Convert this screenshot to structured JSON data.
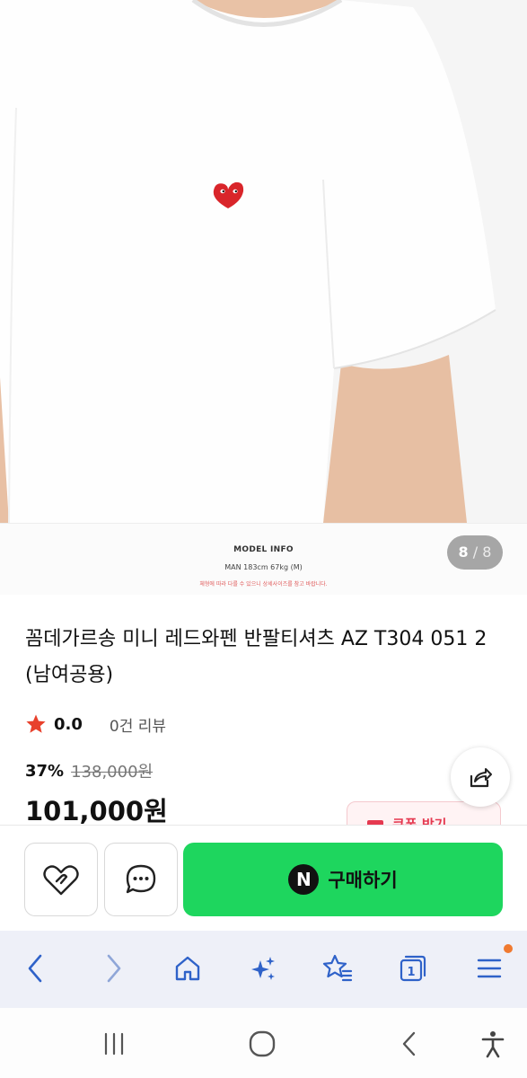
{
  "gallery": {
    "current": "8",
    "separator": "/",
    "total": "8",
    "model_info": {
      "title": "MODEL INFO",
      "spec": "MAN  183cm  67kg (M)",
      "note": "체형에 따라 다를 수 있으니 상세사이즈를 참고 바랍니다."
    }
  },
  "product": {
    "title": "꼼데가르송 미니 레드와펜 반팔티셔츠 AZ T304 051 2 (남여공용)",
    "rating": "0.0",
    "review_count": "0건 리뷰",
    "discount": "37%",
    "original_price": "138,000원",
    "price": "101,000원",
    "coupon_label": "쿠폰 받기"
  },
  "actions": {
    "buy_label": "구매하기",
    "npay_letter": "N"
  },
  "colors": {
    "buy_green": "#1ed65e",
    "star_red": "#e8412c",
    "heart_red": "#d9252a",
    "nav_blue": "#2f62c9"
  },
  "icons": [
    "star-icon",
    "share-icon",
    "heart-hand-icon",
    "chat-bubble-icon",
    "naver-pay-icon",
    "back-arrow-icon",
    "forward-arrow-icon",
    "home-icon",
    "sparkle-icon",
    "bookmark-star-icon",
    "tabs-icon",
    "menu-icon",
    "recent-apps-icon",
    "home-circle-icon",
    "system-back-icon",
    "accessibility-icon"
  ],
  "browser": {
    "tab_count": "1"
  }
}
